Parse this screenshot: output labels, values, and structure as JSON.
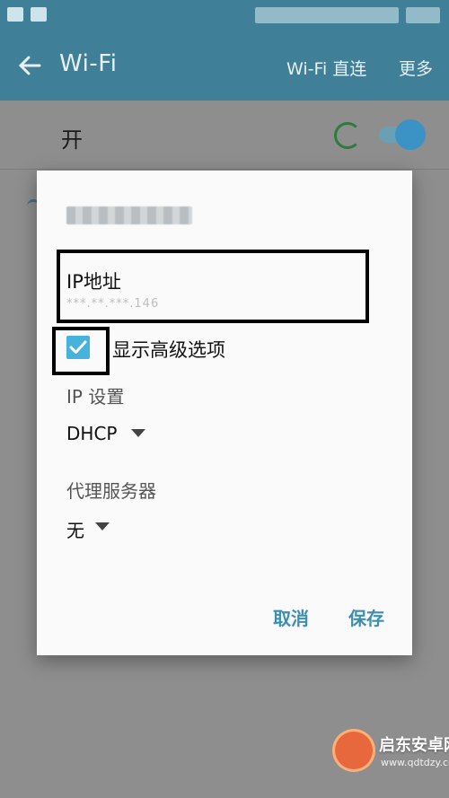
{
  "app_bar": {
    "title": "Wi-Fi",
    "action_direct": "Wi-Fi 直连",
    "action_more": "更多"
  },
  "switch_row": {
    "label": "开",
    "toggle_on": true
  },
  "dialog": {
    "ip_label": "IP地址",
    "ip_value": "***.**.***.146",
    "advanced_checkbox_checked": true,
    "advanced_label": "显示高级选项",
    "ip_settings_label": "IP 设置",
    "ip_settings_value": "DHCP",
    "proxy_label": "代理服务器",
    "proxy_value": "无",
    "cancel_label": "取消",
    "save_label": "保存"
  },
  "watermark": {
    "name": "启东安卓网",
    "url": "www.qdtdzy.com"
  },
  "colors": {
    "app_bar": "#3f7f97",
    "accent": "#3a8fb3",
    "checkbox": "#47b3dd",
    "highlight_border": "#000000"
  }
}
